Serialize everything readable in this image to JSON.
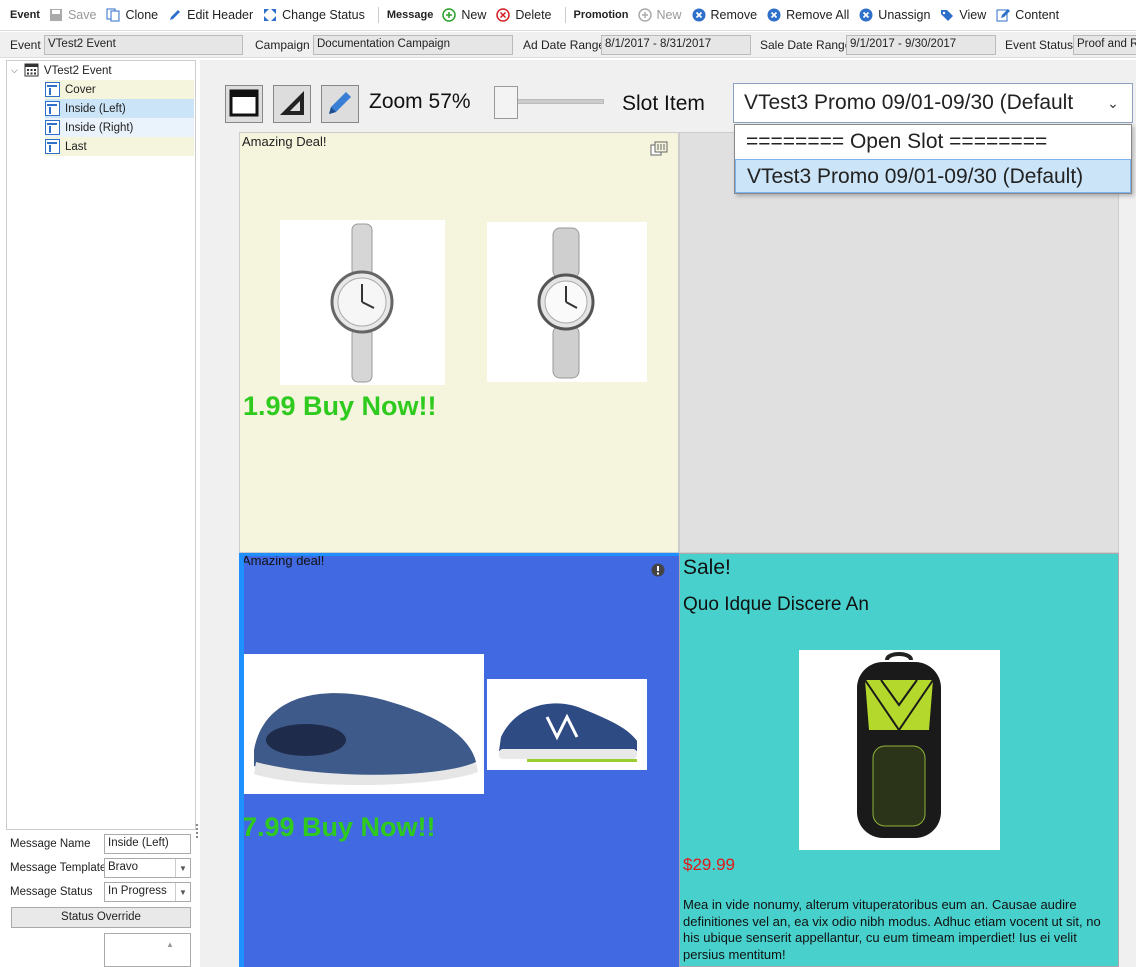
{
  "toolbar": {
    "event_group": "Event",
    "save": "Save",
    "clone": "Clone",
    "edit_header": "Edit Header",
    "change_status": "Change Status",
    "message_group": "Message",
    "new": "New",
    "delete": "Delete",
    "promotion_group": "Promotion",
    "promo_new": "New",
    "remove": "Remove",
    "remove_all": "Remove All",
    "unassign": "Unassign",
    "view": "View",
    "content": "Content"
  },
  "header": {
    "event_label": "Event",
    "event_value": "VTest2 Event",
    "campaign_label": "Campaign",
    "campaign_value": "Documentation Campaign",
    "ad_date_label": "Ad Date Range",
    "ad_date_value": "8/1/2017 - 8/31/2017",
    "sale_date_label": "Sale Date Range",
    "sale_date_value": "9/1/2017 - 9/30/2017",
    "status_label": "Event Status",
    "status_value": "Proof and Re"
  },
  "tree": {
    "root": "VTest2 Event",
    "items": [
      "Cover",
      "Inside (Left)",
      "Inside (Right)",
      "Last"
    ],
    "selected": "Inside (Left)"
  },
  "props": {
    "name_label": "Message Name",
    "name_value": "Inside (Left)",
    "template_label": "Message Template",
    "template_value": "Bravo",
    "status_label": "Message Status",
    "status_value": "In Progress",
    "override_button": "Status Override"
  },
  "viewer": {
    "zoom_label": "Zoom 57%",
    "zoom_level": 0.57,
    "slot_label": "Slot Item",
    "slot_selected": "VTest3 Promo 09/01-09/30 (Default",
    "options": [
      "======== Open Slot ========",
      "VTest3 Promo 09/01-09/30 (Default)"
    ]
  },
  "panels": {
    "p1": {
      "heading": "Amazing Deal!",
      "cta": "1.99 Buy Now!!"
    },
    "p3": {
      "heading": "Amazing deal!",
      "cta": "7.99 Buy Now!!"
    },
    "p4": {
      "heading": "Sale!",
      "subheading": "Quo Idque Discere An",
      "price": "$29.99",
      "body": "Mea in vide nonumy, alterum vituperatoribus eum an. Causae audire definitiones vel an, ea vix odio nibh modus. Adhuc etiam vocent ut sit, no his ubique senserit appellantur, cu eum timeam imperdiet! Ius ei velit persius mentitum!"
    }
  },
  "colors": {
    "panel1_bg": "#f5f4dc",
    "panel3_bg": "#4169e1",
    "panel4_bg": "#48d1cc",
    "cta_green": "#2ecb1e",
    "price_red": "#e0191b"
  }
}
